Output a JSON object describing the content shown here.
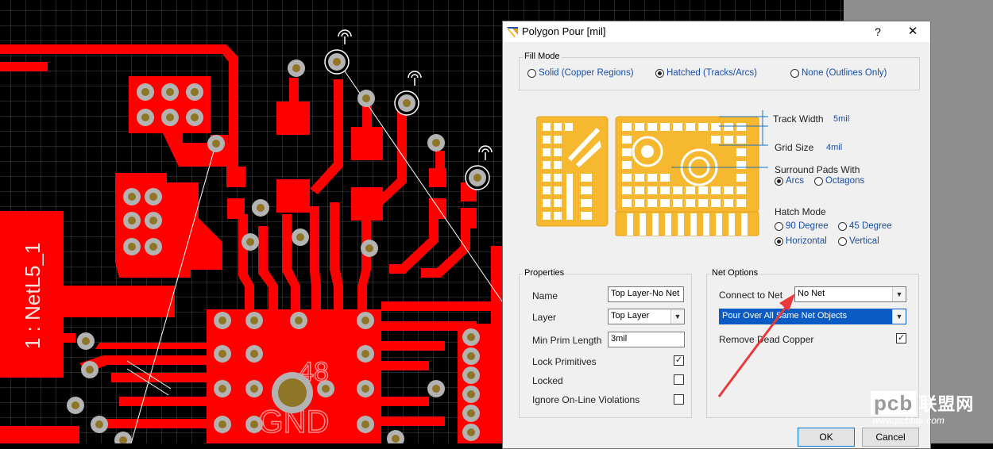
{
  "dialog": {
    "title": "Polygon Pour [mil]",
    "help_label": "?",
    "close_label": "✕"
  },
  "fill_mode": {
    "legend": "Fill Mode",
    "options": [
      "Solid (Copper Regions)",
      "Hatched (Tracks/Arcs)",
      "None (Outlines Only)"
    ],
    "selected": "Hatched (Tracks/Arcs)"
  },
  "hatch_params": {
    "track_width_label": "Track Width",
    "track_width_value": "5mil",
    "grid_size_label": "Grid Size",
    "grid_size_value": "4mil",
    "surround_label": "Surround Pads With",
    "surround_options": [
      "Arcs",
      "Octagons"
    ],
    "surround_selected": "Arcs",
    "hatch_mode_label": "Hatch Mode",
    "hatch_options": [
      "90 Degree",
      "45 Degree",
      "Horizontal",
      "Vertical"
    ],
    "hatch_selected": "Horizontal"
  },
  "properties": {
    "legend": "Properties",
    "name_label": "Name",
    "name_value": "Top Layer-No Net",
    "layer_label": "Layer",
    "layer_value": "Top Layer",
    "min_prim_label": "Min Prim Length",
    "min_prim_value": "3mil",
    "lock_primitives_label": "Lock Primitives",
    "lock_primitives_checked": "✓",
    "locked_label": "Locked",
    "locked_checked": "",
    "ignore_label": "Ignore On-Line Violations",
    "ignore_checked": ""
  },
  "net_options": {
    "legend": "Net Options",
    "connect_label": "Connect to Net",
    "connect_value": "No Net",
    "pour_value": "Pour Over All Same Net Objects",
    "remove_dead_label": "Remove Dead Copper",
    "remove_dead_checked": "✓"
  },
  "buttons": {
    "ok": "OK",
    "cancel": "Cancel"
  },
  "pcb": {
    "component_label": "1 : NetL5_1",
    "pad_number": "48",
    "pad_net": "GND"
  },
  "watermark": {
    "logo_a": "pcb",
    "logo_b": "联盟网",
    "url": "www.pcbbar.com"
  },
  "colors": {
    "copper": "#ff0000",
    "hatch_preview": "#f5b82e",
    "background": "#000000",
    "grid": "#4a4a4a",
    "selection": "#0a5cc4",
    "annotation_arrow": "#e8393b"
  }
}
